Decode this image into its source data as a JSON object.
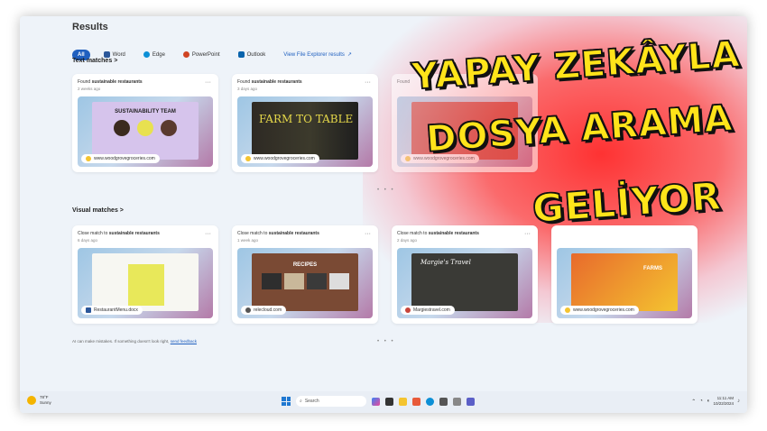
{
  "page": {
    "heading": "Results"
  },
  "filters": [
    {
      "label": "All",
      "active": true
    },
    {
      "label": "Word",
      "color": "#2b579a"
    },
    {
      "label": "Edge",
      "color": "#0c8fd6"
    },
    {
      "label": "PowerPoint",
      "color": "#d04423"
    },
    {
      "label": "Outlook",
      "color": "#0a64ad"
    }
  ],
  "view_explorer": "View File Explorer results",
  "text_matches": {
    "title": "Text matches",
    "chevron": ">",
    "cards": [
      {
        "prefix": "Found",
        "query": "sustainable restaurants",
        "age": "2 weeks ago",
        "thumb_text": "SUSTAINABILITY TEAM",
        "url": "www.woodgrovegroceries.com"
      },
      {
        "prefix": "Found",
        "query": "sustainable restaurants",
        "age": "3 days ago",
        "thumb_text": "FARM TO TABLE",
        "url": "www.woodgrovegroceries.com"
      },
      {
        "prefix": "Found",
        "query": "",
        "age": "",
        "thumb_text": "",
        "url": "www.woodgrovegroceries.com"
      }
    ]
  },
  "visual_matches": {
    "title": "Visual matches",
    "chevron": ">",
    "cards": [
      {
        "prefix": "Close match to",
        "query": "sustainable restaurants",
        "age": "6 days ago",
        "thumb_text": "",
        "url": "RestaurantMenu.docx"
      },
      {
        "prefix": "Close match to",
        "query": "sustainable restaurants",
        "age": "1 week ago",
        "thumb_text": "RECIPES",
        "url": "relecloud.com"
      },
      {
        "prefix": "Close match to",
        "query": "sustainable restaurants",
        "age": "2 days ago",
        "thumb_text": "Margie's Travel",
        "url": "Margiestravel.com"
      },
      {
        "prefix": "",
        "query": "",
        "age": "",
        "thumb_text": "FARMS",
        "url": "www.woodgrovegroceries.com"
      }
    ]
  },
  "pager_dots": "• • •",
  "footer": {
    "note": "AI can make mistakes. If something doesn't look right,",
    "link": "send feedback"
  },
  "taskbar": {
    "temp": "78°F",
    "condition": "Sunny",
    "search_placeholder": "Search",
    "time": "11:11 AM",
    "date": "10/22/2024"
  },
  "headline": {
    "line1": "YAPAY ZEKÂYLA",
    "line2": "DOSYA ARAMA",
    "line3": "GELİYOR"
  },
  "colors": {
    "accent": "#1f5fbf",
    "headline_fill": "#ffe41a",
    "glow": "#ff2828"
  }
}
